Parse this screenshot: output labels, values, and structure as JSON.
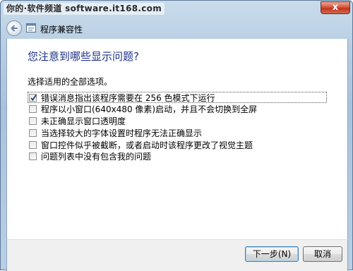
{
  "window": {
    "watermark_text": "你的·软件频道 software.it168.com",
    "close_symbol": "x",
    "nav_title": "程序兼容性"
  },
  "main": {
    "heading": "您注意到哪些显示问题?",
    "instruction": "选择适用的全部选项。",
    "options": [
      {
        "label": "错误消息指出该程序需要在 256 色模式下运行",
        "checked": true
      },
      {
        "label": "程序以小窗口(640x480 像素)启动，并且不会切换到全屏",
        "checked": false
      },
      {
        "label": "未正确显示窗口透明度",
        "checked": false
      },
      {
        "label": "当选择较大的字体设置时程序无法正确显示",
        "checked": false
      },
      {
        "label": "窗口控件似乎被截断，或者启动时该程序更改了视觉主题",
        "checked": false
      },
      {
        "label": "问题列表中没有包含我的问题",
        "checked": false
      }
    ]
  },
  "footer": {
    "next_label": "下一步(N)",
    "cancel_label": "取消"
  },
  "icons": {
    "back": "back-arrow-icon",
    "app": "program-compatibility-icon",
    "check": "checkmark-icon"
  },
  "colors": {
    "heading": "#1e3287",
    "frame": "#b7cde2",
    "close": "#c0351c"
  }
}
